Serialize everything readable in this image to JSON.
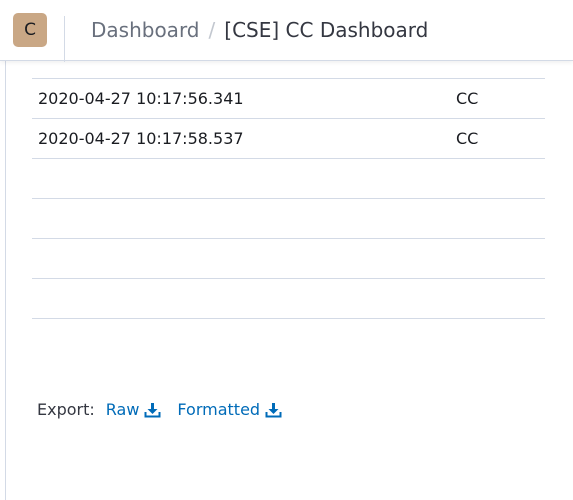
{
  "header": {
    "avatar_letter": "C",
    "breadcrumb": {
      "parent": "Dashboard",
      "separator": "/",
      "current": "[CSE] CC Dashboard"
    }
  },
  "table": {
    "rows": [
      {
        "timestamp": "2020-04-27 10:17:56.341",
        "source": "CC"
      },
      {
        "timestamp": "2020-04-27 10:17:58.537",
        "source": "CC"
      },
      {
        "timestamp": "",
        "source": ""
      },
      {
        "timestamp": "",
        "source": ""
      },
      {
        "timestamp": "",
        "source": ""
      },
      {
        "timestamp": "",
        "source": ""
      }
    ]
  },
  "export": {
    "label": "Export:",
    "raw_label": "Raw",
    "formatted_label": "Formatted",
    "icon": "download-icon"
  },
  "colors": {
    "link": "#006bb8",
    "avatar_bg": "#c9a785",
    "border": "#d3dae6"
  }
}
